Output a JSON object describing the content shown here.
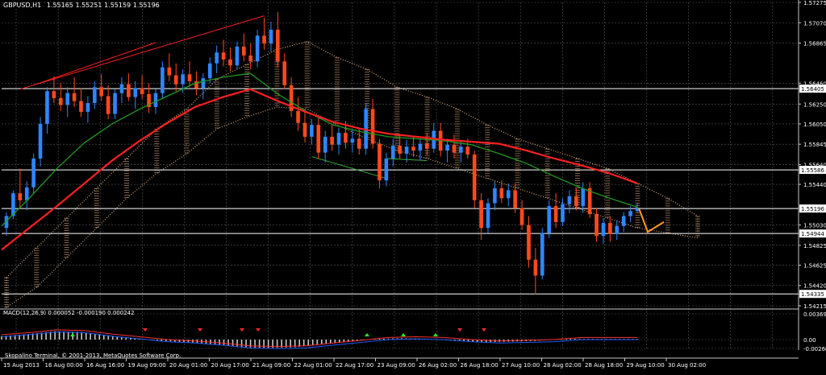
{
  "header": {
    "symbol": "GBPUSD,H1",
    "ohlc": "1.55165 1.55251 1.55159 1.55196"
  },
  "macd": {
    "label": "MACD(12,26,9) 0.000052 -0.000190 0.000242",
    "ticks": [
      "0.003693",
      "0.00",
      "-0.002602"
    ]
  },
  "footer": {
    "copyright": "Skopalino Terminal, © 2001-2013, MetaQuotes Software Corp."
  },
  "colors": {
    "background": "#000000",
    "grid": "#5a5a5a",
    "bull_candle": "#2e86ff",
    "bear_candle": "#ff4a1c",
    "ma_red": "#ff2020",
    "ma_green": "#1f9a1f",
    "cloud": "#d9a57a",
    "forecast": "#ff9a1a",
    "hline": "#ffffff",
    "macd_hist": "#c8c8c8",
    "macd_signal": "#ff3030",
    "macd_line": "#1e5cff",
    "arrow_up": "#22ff22",
    "arrow_down": "#ff2a2a"
  },
  "chart_data": {
    "type": "candlestick",
    "instrument": "GBPUSD",
    "timeframe": "H1",
    "last_bar": {
      "open": 1.55165,
      "high": 1.55251,
      "low": 1.55159,
      "close": 1.55196
    },
    "price_ticks": [
      "1.57275",
      "1.57070",
      "1.56865",
      "1.56460",
      "1.56250",
      "1.56050",
      "1.55845",
      "1.55640",
      "1.55440",
      "1.55030",
      "1.54825",
      "1.54625",
      "1.54420",
      "1.54215"
    ],
    "tick_values": [
      1.57275,
      1.5707,
      1.56865,
      1.5646,
      1.5625,
      1.5605,
      1.55845,
      1.5564,
      1.5544,
      1.5503,
      1.54825,
      1.54625,
      1.5442,
      1.54215
    ],
    "horizontal_levels": [
      {
        "label": "1.56405",
        "value": 1.56405
      },
      {
        "label": "1.55586",
        "value": 1.55586
      },
      {
        "label": "1.55196",
        "value": 1.55196
      },
      {
        "label": "1.54944",
        "value": 1.54944
      },
      {
        "label": "1.54335",
        "value": 1.54335
      }
    ],
    "x_labels": [
      "15 Aug 2013",
      "16 Aug 00:00",
      "16 Aug 16:00",
      "19 Aug 09:00",
      "20 Aug 01:00",
      "20 Aug 17:00",
      "21 Aug 09:00",
      "22 Aug 01:00",
      "22 Aug 17:00",
      "23 Aug 09:00",
      "26 Aug 02:00",
      "26 Aug 18:00",
      "27 Aug 10:00",
      "28 Aug 02:00",
      "28 Aug 18:00",
      "29 Aug 10:00",
      "30 Aug 02:00"
    ],
    "candles": [
      [
        1.55,
        1.5516,
        1.5492,
        1.5512
      ],
      [
        1.5512,
        1.5538,
        1.5509,
        1.5535
      ],
      [
        1.5535,
        1.556,
        1.5521,
        1.5528
      ],
      [
        1.5528,
        1.5547,
        1.5518,
        1.5541
      ],
      [
        1.5541,
        1.5575,
        1.5535,
        1.557
      ],
      [
        1.557,
        1.5612,
        1.5562,
        1.5605
      ],
      [
        1.5605,
        1.5642,
        1.5595,
        1.5638
      ],
      [
        1.5638,
        1.5653,
        1.5626,
        1.5631
      ],
      [
        1.5631,
        1.5646,
        1.5618,
        1.5624
      ],
      [
        1.5624,
        1.5642,
        1.5612,
        1.5636
      ],
      [
        1.5636,
        1.5652,
        1.5622,
        1.5628
      ],
      [
        1.5628,
        1.5641,
        1.5612,
        1.5617
      ],
      [
        1.5617,
        1.5633,
        1.5606,
        1.5626
      ],
      [
        1.5626,
        1.5648,
        1.562,
        1.5642
      ],
      [
        1.5642,
        1.5655,
        1.5628,
        1.5633
      ],
      [
        1.5633,
        1.5644,
        1.561,
        1.5615
      ],
      [
        1.5615,
        1.564,
        1.561,
        1.5636
      ],
      [
        1.5636,
        1.5652,
        1.5626,
        1.5645
      ],
      [
        1.5645,
        1.5656,
        1.5628,
        1.5632
      ],
      [
        1.5632,
        1.5648,
        1.562,
        1.5641
      ],
      [
        1.5641,
        1.5654,
        1.563,
        1.5635
      ],
      [
        1.5635,
        1.5646,
        1.5616,
        1.5622
      ],
      [
        1.5622,
        1.564,
        1.5615,
        1.5636
      ],
      [
        1.5636,
        1.5668,
        1.563,
        1.5662
      ],
      [
        1.5662,
        1.5676,
        1.5648,
        1.5654
      ],
      [
        1.5654,
        1.5666,
        1.5638,
        1.5645
      ],
      [
        1.5645,
        1.566,
        1.5636,
        1.5655
      ],
      [
        1.5655,
        1.5668,
        1.5642,
        1.5648
      ],
      [
        1.5648,
        1.5658,
        1.5634,
        1.5641
      ],
      [
        1.5641,
        1.5656,
        1.563,
        1.5651
      ],
      [
        1.5651,
        1.5672,
        1.5646,
        1.5666
      ],
      [
        1.5666,
        1.5684,
        1.5656,
        1.5677
      ],
      [
        1.5677,
        1.569,
        1.5663,
        1.567
      ],
      [
        1.567,
        1.5682,
        1.5658,
        1.5664
      ],
      [
        1.5664,
        1.5688,
        1.566,
        1.5683
      ],
      [
        1.5683,
        1.5696,
        1.5668,
        1.5674
      ],
      [
        1.5674,
        1.5686,
        1.566,
        1.5668
      ],
      [
        1.5668,
        1.57,
        1.5662,
        1.5694
      ],
      [
        1.5694,
        1.5712,
        1.568,
        1.5686
      ],
      [
        1.5686,
        1.5708,
        1.5678,
        1.57
      ],
      [
        1.57,
        1.5718,
        1.5662,
        1.5668
      ],
      [
        1.5668,
        1.5676,
        1.564,
        1.5644
      ],
      [
        1.5644,
        1.5652,
        1.5612,
        1.5618
      ],
      [
        1.5618,
        1.5632,
        1.5598,
        1.5606
      ],
      [
        1.5606,
        1.562,
        1.5586,
        1.5592
      ],
      [
        1.5592,
        1.561,
        1.5584,
        1.5604
      ],
      [
        1.5604,
        1.5612,
        1.557,
        1.5576
      ],
      [
        1.5576,
        1.5598,
        1.5566,
        1.5592
      ],
      [
        1.5592,
        1.5604,
        1.5578,
        1.5584
      ],
      [
        1.5584,
        1.5601,
        1.5574,
        1.5596
      ],
      [
        1.5596,
        1.5608,
        1.558,
        1.5586
      ],
      [
        1.5586,
        1.5599,
        1.5576,
        1.559
      ],
      [
        1.559,
        1.56,
        1.5574,
        1.558
      ],
      [
        1.558,
        1.5626,
        1.5574,
        1.562
      ],
      [
        1.562,
        1.563,
        1.558,
        1.5585
      ],
      [
        1.5585,
        1.559,
        1.554,
        1.5548
      ],
      [
        1.5548,
        1.5576,
        1.5542,
        1.557
      ],
      [
        1.557,
        1.559,
        1.5562,
        1.5583
      ],
      [
        1.5583,
        1.5594,
        1.557,
        1.5575
      ],
      [
        1.5575,
        1.5589,
        1.5566,
        1.5582
      ],
      [
        1.5582,
        1.5593,
        1.5572,
        1.5578
      ],
      [
        1.5578,
        1.559,
        1.5568,
        1.5585
      ],
      [
        1.5585,
        1.5596,
        1.5574,
        1.558
      ],
      [
        1.558,
        1.5606,
        1.5576,
        1.5598
      ],
      [
        1.5598,
        1.5606,
        1.5572,
        1.5578
      ],
      [
        1.5578,
        1.559,
        1.5566,
        1.5584
      ],
      [
        1.5584,
        1.5594,
        1.557,
        1.5576
      ],
      [
        1.5576,
        1.5588,
        1.5566,
        1.5582
      ],
      [
        1.5582,
        1.559,
        1.557,
        1.5574
      ],
      [
        1.5574,
        1.5578,
        1.552,
        1.5528
      ],
      [
        1.5528,
        1.5535,
        1.5488,
        1.55
      ],
      [
        1.55,
        1.553,
        1.5495,
        1.5525
      ],
      [
        1.5525,
        1.5547,
        1.5518,
        1.554
      ],
      [
        1.554,
        1.5548,
        1.5525,
        1.553
      ],
      [
        1.553,
        1.5545,
        1.5522,
        1.5538
      ],
      [
        1.5538,
        1.5545,
        1.5515,
        1.552
      ],
      [
        1.552,
        1.5528,
        1.5498,
        1.5503
      ],
      [
        1.5503,
        1.5512,
        1.546,
        1.5468
      ],
      [
        1.5468,
        1.548,
        1.5433,
        1.5452
      ],
      [
        1.5452,
        1.55,
        1.5448,
        1.5495
      ],
      [
        1.5495,
        1.5528,
        1.549,
        1.5522
      ],
      [
        1.5522,
        1.5535,
        1.55,
        1.5506
      ],
      [
        1.5506,
        1.553,
        1.5502,
        1.5524
      ],
      [
        1.5524,
        1.5538,
        1.5515,
        1.5532
      ],
      [
        1.5532,
        1.554,
        1.5518,
        1.5522
      ],
      [
        1.5522,
        1.5546,
        1.5515,
        1.554
      ],
      [
        1.554,
        1.5546,
        1.551,
        1.5514
      ],
      [
        1.5514,
        1.552,
        1.5486,
        1.5492
      ],
      [
        1.5492,
        1.551,
        1.5484,
        1.5505
      ],
      [
        1.5505,
        1.5512,
        1.5486,
        1.5494
      ],
      [
        1.5494,
        1.5508,
        1.5488,
        1.5502
      ],
      [
        1.5502,
        1.5516,
        1.5496,
        1.5512
      ],
      [
        1.5512,
        1.5522,
        1.5506,
        1.5517
      ],
      [
        1.5517,
        1.5525,
        1.5516,
        1.552
      ]
    ],
    "ma_red": [
      1.5478,
      1.55,
      1.5522,
      1.5545,
      1.5568,
      1.5588,
      1.5606,
      1.5622,
      1.5632,
      1.564,
      1.5628,
      1.5617,
      1.5607,
      1.56,
      1.5595,
      1.5592,
      1.5589,
      1.5587,
      1.5585,
      1.5578,
      1.557,
      1.5563,
      1.5555,
      1.5545
    ],
    "ma_green": [
      1.5502,
      1.553,
      1.556,
      1.5586,
      1.5605,
      1.562,
      1.5633,
      1.5646,
      1.5652,
      1.5656,
      1.5635,
      1.5618,
      1.5604,
      1.5597,
      1.5592,
      1.559,
      1.5588,
      1.5584,
      1.5575,
      1.5565,
      1.5552,
      1.554,
      1.553,
      1.5521
    ],
    "cloud_top": [
      1.545,
      1.548,
      1.551,
      1.554,
      1.557,
      1.56,
      1.562,
      1.565,
      1.5665,
      1.568,
      1.5688,
      1.5672,
      1.566,
      1.5642,
      1.5632,
      1.562,
      1.5604,
      1.559,
      1.558,
      1.557,
      1.556,
      1.5545,
      1.553,
      1.5512
    ],
    "cloud_bottom": [
      1.542,
      1.544,
      1.547,
      1.55,
      1.553,
      1.5555,
      1.5575,
      1.56,
      1.5612,
      1.5622,
      1.562,
      1.5604,
      1.559,
      1.5578,
      1.557,
      1.556,
      1.555,
      1.554,
      1.553,
      1.552,
      1.551,
      1.55,
      1.5495,
      1.549
    ],
    "forecast": [
      1.552,
      1.5496,
      1.5506
    ],
    "macd_hist": [
      0.0005,
      0.0008,
      0.0012,
      0.0011,
      0.0006,
      0.0002,
      -0.0002,
      -0.0004,
      -0.0007,
      -0.0011,
      -0.0012,
      -0.0011,
      -0.0007,
      -0.0003,
      0.0001,
      0.0002,
      0.0001,
      -0.0002,
      -0.0004,
      -0.0003,
      -0.0002,
      0.0001,
      0.0001,
      0.0001
    ]
  }
}
